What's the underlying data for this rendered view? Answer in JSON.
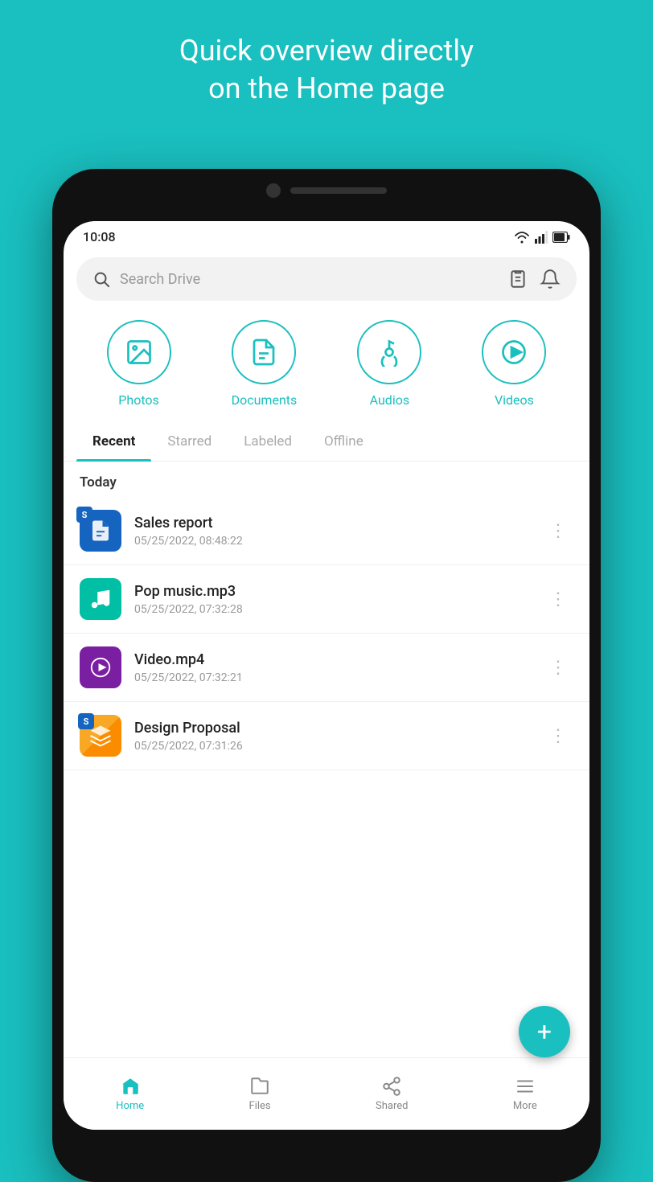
{
  "hero": {
    "line1": "Quick overview directly",
    "line2": "on the Home page"
  },
  "statusBar": {
    "time": "10:08"
  },
  "search": {
    "placeholder": "Search Drive"
  },
  "categories": [
    {
      "id": "photos",
      "label": "Photos"
    },
    {
      "id": "documents",
      "label": "Documents"
    },
    {
      "id": "audios",
      "label": "Audios"
    },
    {
      "id": "videos",
      "label": "Videos"
    }
  ],
  "tabs": [
    {
      "id": "recent",
      "label": "Recent",
      "active": true
    },
    {
      "id": "starred",
      "label": "Starred",
      "active": false
    },
    {
      "id": "labeled",
      "label": "Labeled",
      "active": false
    },
    {
      "id": "offline",
      "label": "Offline",
      "active": false
    }
  ],
  "sectionHeader": "Today",
  "files": [
    {
      "id": "file1",
      "name": "Sales report",
      "date": "05/25/2022, 08:48:22",
      "type": "doc"
    },
    {
      "id": "file2",
      "name": "Pop music.mp3",
      "date": "05/25/2022, 07:32:28",
      "type": "audio"
    },
    {
      "id": "file3",
      "name": "Video.mp4",
      "date": "05/25/2022, 07:32:21",
      "type": "video"
    },
    {
      "id": "file4",
      "name": "Design Proposal",
      "date": "05/25/2022, 07:31:26",
      "type": "design"
    }
  ],
  "fab": "+",
  "bottomNav": [
    {
      "id": "home",
      "label": "Home",
      "active": true
    },
    {
      "id": "files",
      "label": "Files",
      "active": false
    },
    {
      "id": "shared",
      "label": "Shared",
      "active": false
    },
    {
      "id": "more",
      "label": "More",
      "active": false
    }
  ]
}
